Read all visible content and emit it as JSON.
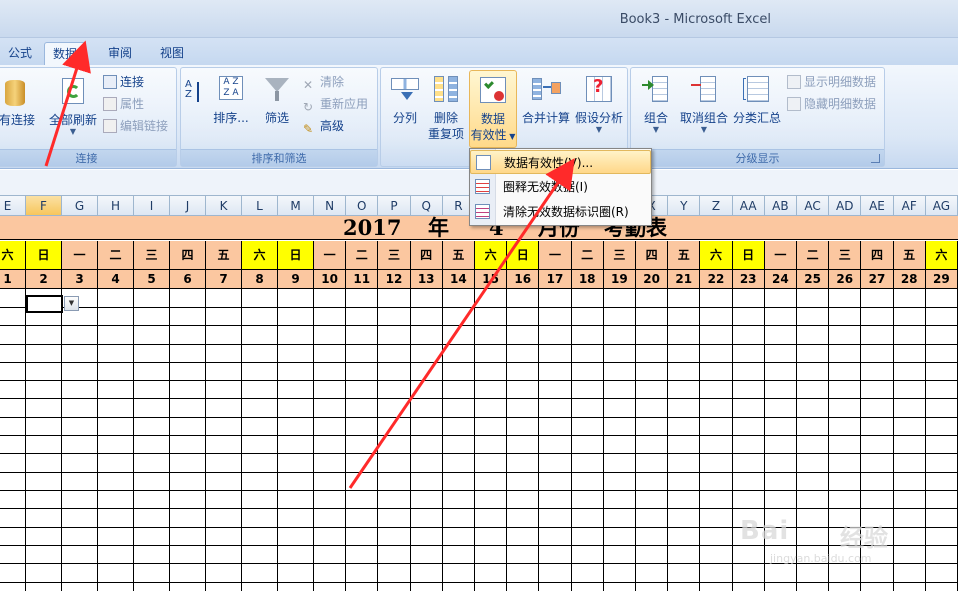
{
  "window": {
    "title": "Book3 - Microsoft Excel"
  },
  "tabs": [
    {
      "label": "公式",
      "active": false
    },
    {
      "label": "数据",
      "active": true
    },
    {
      "label": "审阅",
      "active": false
    },
    {
      "label": "视图",
      "active": false
    }
  ],
  "ribbon": {
    "connections": {
      "label": "连接",
      "existing_connections": "有连接",
      "refresh_all": "全部刷新",
      "connections": "连接",
      "properties": "属性",
      "edit_links": "编辑链接"
    },
    "sort_filter": {
      "label": "排序和筛选",
      "sort": "排序...",
      "filter": "筛选",
      "clear": "清除",
      "reapply": "重新应用",
      "advanced": "高级"
    },
    "data_tools": {
      "text_to_columns": "分列",
      "remove_duplicates_1": "删除",
      "remove_duplicates_2": "重复项",
      "data_validation_1": "数据",
      "data_validation_2": "有效性",
      "consolidate": "合并计算",
      "what_if": "假设分析"
    },
    "outline": {
      "label": "分级显示",
      "group": "组合",
      "ungroup": "取消组合",
      "subtotal": "分类汇总",
      "show_detail": "显示明细数据",
      "hide_detail": "隐藏明细数据"
    }
  },
  "dropdown_menu": {
    "items": [
      {
        "label": "数据有效性(V)...",
        "highlighted": true
      },
      {
        "label": "圈释无效数据(I)",
        "highlighted": false
      },
      {
        "label": "清除无效数据标识圈(R)",
        "highlighted": false
      }
    ]
  },
  "sheet": {
    "column_headers": [
      "E",
      "F",
      "G",
      "H",
      "I",
      "J",
      "K",
      "L",
      "M",
      "N",
      "O",
      "P",
      "Q",
      "R",
      "S",
      "T",
      "U",
      "V",
      "W",
      "X",
      "Y",
      "Z",
      "AA",
      "AB",
      "AC",
      "AD",
      "AE",
      "AF",
      "AG"
    ],
    "selected_column": "F",
    "title": {
      "year": "2017",
      "year_unit": "年",
      "month": "4",
      "month_unit": "月份",
      "name": "考勤表"
    },
    "weekdays": [
      "六",
      "日",
      "一",
      "二",
      "三",
      "四",
      "五",
      "六",
      "日",
      "一",
      "二",
      "三",
      "四",
      "五",
      "六",
      "日",
      "一",
      "二",
      "三",
      "四",
      "五",
      "六",
      "日",
      "一",
      "二",
      "三",
      "四",
      "五",
      "六"
    ],
    "days": [
      "1",
      "2",
      "3",
      "4",
      "5",
      "6",
      "7",
      "8",
      "9",
      "10",
      "11",
      "12",
      "13",
      "14",
      "15",
      "16",
      "17",
      "18",
      "19",
      "20",
      "21",
      "22",
      "23",
      "24",
      "25",
      "26",
      "27",
      "28",
      "29"
    ]
  },
  "watermark": {
    "brand": "Bai",
    "brand2": "经验",
    "url": "jingyan.baidu.com"
  },
  "colors": {
    "weekday_fill": "#fbc7a0",
    "weekend_fill": "#ffff00",
    "arrow": "#ff2a2a",
    "header_selected": "#f7c65c"
  }
}
